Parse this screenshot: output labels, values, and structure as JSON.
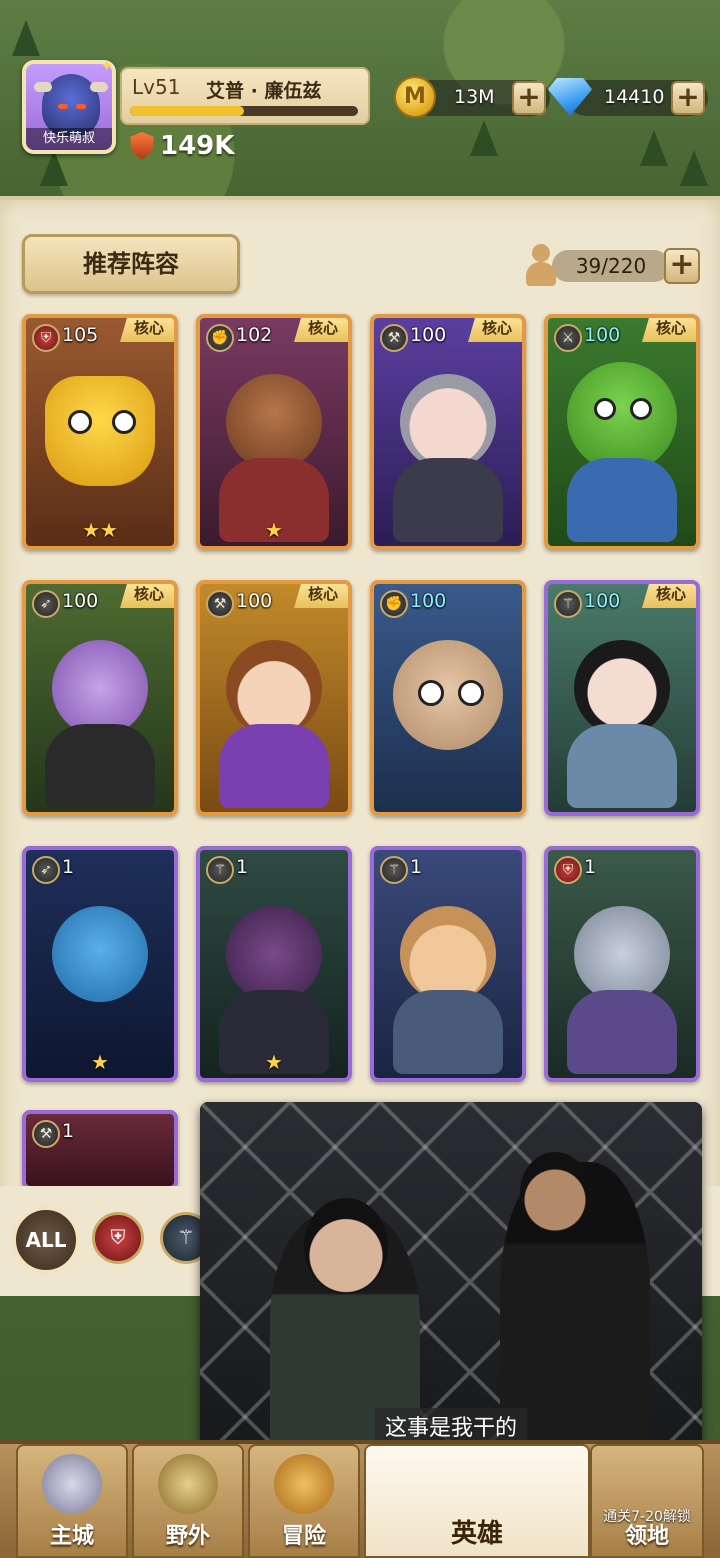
{
  "player": {
    "avatar_name": "快乐萌叔",
    "level": "Lv51",
    "name": "艾普 · 廉伍兹",
    "xp_fraction": 0.5,
    "power": "149K"
  },
  "resources": {
    "coin_icon_letter": "M",
    "coins": "13M",
    "gems": "14410",
    "plus": "+"
  },
  "panel": {
    "recommend_label": "推荐阵容",
    "capacity": "39/220",
    "plus": "+"
  },
  "heroes": [
    {
      "level": "105",
      "core": "核心",
      "stars": "★★",
      "class_icon": "shield-icon"
    },
    {
      "level": "102",
      "core": "核心",
      "stars": "★",
      "class_icon": "fist-icon"
    },
    {
      "level": "100",
      "core": "核心",
      "stars": "",
      "class_icon": "axe-icon"
    },
    {
      "level": "100",
      "core": "核心",
      "stars": "",
      "class_icon": "crossed-swords-icon"
    },
    {
      "level": "100",
      "core": "核心",
      "stars": "",
      "class_icon": "bow-icon"
    },
    {
      "level": "100",
      "core": "核心",
      "stars": "",
      "class_icon": "axe-icon"
    },
    {
      "level": "100",
      "core": "",
      "stars": "",
      "class_icon": "fist-icon"
    },
    {
      "level": "100",
      "core": "核心",
      "stars": "",
      "class_icon": "staff-icon"
    },
    {
      "level": "1",
      "core": "",
      "stars": "★",
      "class_icon": "bow-icon"
    },
    {
      "level": "1",
      "core": "",
      "stars": "★",
      "class_icon": "staff-icon"
    },
    {
      "level": "1",
      "core": "",
      "stars": "",
      "class_icon": "staff-icon"
    },
    {
      "level": "1",
      "core": "",
      "stars": "",
      "class_icon": "shield-icon"
    },
    {
      "level": "1",
      "core": "",
      "stars": "",
      "class_icon": "axe-icon"
    }
  ],
  "filters": {
    "all": "ALL"
  },
  "video": {
    "subtitle": "这事是我干的"
  },
  "nav": {
    "items": [
      {
        "label": "主城"
      },
      {
        "label": "野外"
      },
      {
        "label": "冒险"
      },
      {
        "label": "英雄"
      },
      {
        "label": "领地",
        "lock_note": "通关7-20解锁"
      }
    ]
  }
}
